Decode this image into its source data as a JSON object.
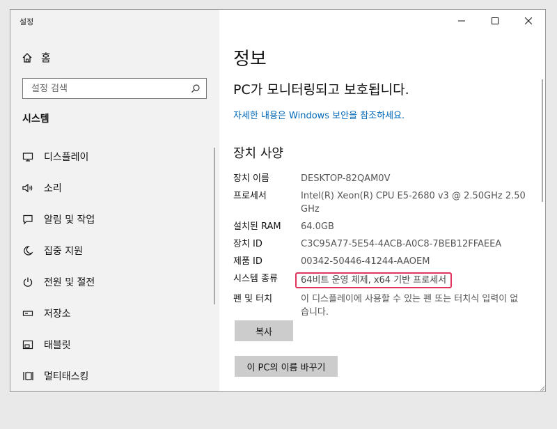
{
  "window": {
    "title": "설정"
  },
  "sidebar": {
    "home_label": "홈",
    "search_placeholder": "설정 검색",
    "section_title": "시스템",
    "items": [
      {
        "label": "디스플레이",
        "icon": "monitor-icon"
      },
      {
        "label": "소리",
        "icon": "speaker-icon"
      },
      {
        "label": "알림 및 작업",
        "icon": "notification-icon"
      },
      {
        "label": "집중 지원",
        "icon": "moon-icon"
      },
      {
        "label": "전원 및 절전",
        "icon": "power-icon"
      },
      {
        "label": "저장소",
        "icon": "storage-icon"
      },
      {
        "label": "태블릿",
        "icon": "tablet-icon"
      },
      {
        "label": "멀티태스킹",
        "icon": "multitasking-icon"
      }
    ]
  },
  "main": {
    "title": "정보",
    "protection_status": "PC가 모니터링되고 보호됩니다.",
    "security_link": "자세한 내용은 Windows 보안을 참조하세요.",
    "specs_title": "장치 사양",
    "specs": [
      {
        "key": "장치 이름",
        "value": "DESKTOP-82QAM0V"
      },
      {
        "key": "프로세서",
        "value": "Intel(R) Xeon(R) CPU E5-2680 v3 @ 2.50GHz   2.50 GHz"
      },
      {
        "key": "설치된 RAM",
        "value": "64.0GB"
      },
      {
        "key": "장치 ID",
        "value": "C3C95A77-5E54-4ACB-A0C8-7BEB12FFAEEA"
      },
      {
        "key": "제품 ID",
        "value": "00342-50446-41244-AAOEM"
      },
      {
        "key": "시스템 종류",
        "value": "64비트 운영 체제, x64 기반 프로세서"
      },
      {
        "key": "펜 및 터치",
        "value": "이 디스플레이에 사용할 수 있는 펜 또는 터치식 입력이 없습니다."
      }
    ],
    "copy_button": "복사",
    "rename_button": "이 PC의 이름 바꾸기"
  },
  "colors": {
    "link": "#0067b8",
    "highlight_border": "#e0345d",
    "sidebar_bg": "#f2f2f2"
  }
}
